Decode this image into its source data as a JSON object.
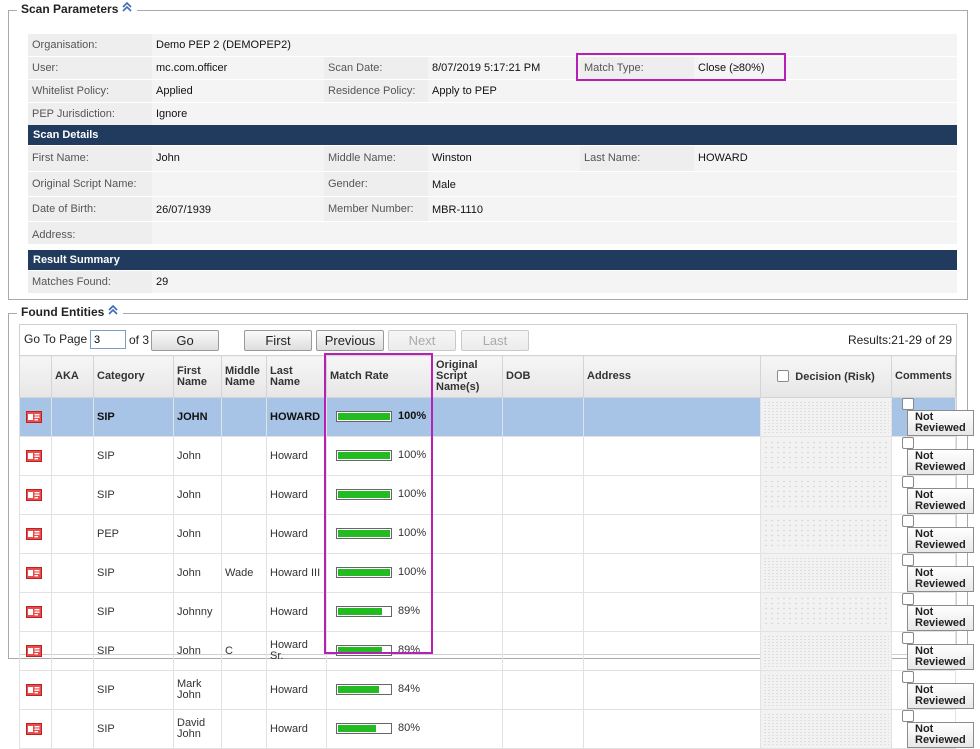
{
  "scan_parameters": {
    "title": "Scan Parameters",
    "rows": [
      [
        {
          "label": "Organisation:",
          "value": "Demo PEP 2 (DEMOPEP2)"
        }
      ],
      [
        {
          "label": "User:",
          "value": "mc.com.officer"
        },
        {
          "label": "Scan Date:",
          "value": "8/07/2019 5:17:21 PM"
        },
        {
          "label": "Match Type:",
          "value": "Close (≥80%)"
        }
      ],
      [
        {
          "label": "Whitelist Policy:",
          "value": "Applied"
        },
        {
          "label": "Residence Policy:",
          "value": "Apply to PEP"
        }
      ],
      [
        {
          "label": "PEP Jurisdiction:",
          "value": "Ignore"
        }
      ]
    ],
    "scan_details_title": "Scan Details",
    "detail_rows": [
      [
        {
          "label": "First Name:",
          "value": "John"
        },
        {
          "label": "Middle Name:",
          "value": "Winston"
        },
        {
          "label": "Last Name:",
          "value": "HOWARD"
        }
      ],
      [
        {
          "label": "Original Script Name:",
          "value": ""
        },
        {
          "label": "Gender:",
          "value": "Male"
        }
      ],
      [
        {
          "label": "Date of Birth:",
          "value": "26/07/1939"
        },
        {
          "label": "Member Number:",
          "value": "MBR-1110"
        }
      ],
      [
        {
          "label": "Address:",
          "value": ""
        }
      ]
    ],
    "result_summary_title": "Result Summary",
    "matches_found": {
      "label": "Matches Found:",
      "value": "29"
    }
  },
  "found_entities": {
    "title": "Found Entities",
    "pager": {
      "go_to_page_label": "Go To Page",
      "page_value": "3",
      "of_label": "of 3",
      "go_label": "Go",
      "first_label": "First",
      "previous_label": "Previous",
      "next_label": "Next",
      "last_label": "Last",
      "results_label": "Results:21-29 of 29"
    },
    "columns": [
      "AKA",
      "Category",
      "First Name",
      "Middle Name",
      "Last Name",
      "Match Rate",
      "Original Script Name(s)",
      "DOB",
      "Address",
      "Decision (Risk)",
      "Comments"
    ],
    "decision_label": "Not Reviewed",
    "rows": [
      {
        "category": "SIP",
        "first": "JOHN",
        "middle": "",
        "last": "HOWARD",
        "rate": 100,
        "rate_text": "100%",
        "selected": true
      },
      {
        "category": "SIP",
        "first": "John",
        "middle": "",
        "last": "Howard",
        "rate": 100,
        "rate_text": "100%"
      },
      {
        "category": "SIP",
        "first": "John",
        "middle": "",
        "last": "Howard",
        "rate": 100,
        "rate_text": "100%"
      },
      {
        "category": "PEP",
        "first": "John",
        "middle": "",
        "last": "Howard",
        "rate": 100,
        "rate_text": "100%"
      },
      {
        "category": "SIP",
        "first": "John",
        "middle": "Wade",
        "last": "Howard III",
        "rate": 100,
        "rate_text": "100%"
      },
      {
        "category": "SIP",
        "first": "Johnny",
        "middle": "",
        "last": "Howard",
        "rate": 89,
        "rate_text": "89%"
      },
      {
        "category": "SIP",
        "first": "John",
        "middle": "C",
        "last": "Howard Sr.",
        "rate": 89,
        "rate_text": "89%"
      },
      {
        "category": "SIP",
        "first": "Mark John",
        "middle": "",
        "last": "Howard",
        "rate": 84,
        "rate_text": "84%"
      },
      {
        "category": "SIP",
        "first": "David John",
        "middle": "",
        "last": "Howard",
        "rate": 80,
        "rate_text": "80%"
      }
    ]
  },
  "colors": {
    "accent_bar": "#203b5e",
    "highlight": "#b620b6",
    "match_bar": "#22bb22"
  }
}
